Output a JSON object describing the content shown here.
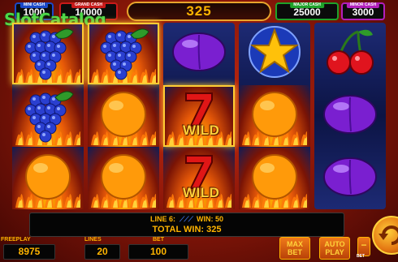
{
  "watermark": "SlotCatalog",
  "jackpots": {
    "mini": {
      "label": "MINI CASH",
      "value": "1000"
    },
    "grand": {
      "label": "GRAND CASH",
      "value": "10000"
    },
    "major": {
      "label": "MAJOR CASH",
      "value": "25000"
    },
    "minor": {
      "label": "MINOR CASH",
      "value": "3000"
    }
  },
  "win_display": "325",
  "reels": [
    [
      "grapes",
      "grapes",
      "orange"
    ],
    [
      "grapes",
      "orange",
      "orange"
    ],
    [
      "plum",
      "wild",
      "wild"
    ],
    [
      "star",
      "orange",
      "orange"
    ],
    [
      "cherries",
      "plum",
      "plum"
    ]
  ],
  "wild_text": "WILD",
  "info": {
    "line_label": "LINE 6:",
    "line_glyph": "⟋⟋⟋",
    "win_label": "WIN: 50",
    "total_win_label": "TOTAL WIN: 325"
  },
  "controls": {
    "freeplay_label": "FREEPLAY",
    "freeplay_value": "8975",
    "lines_label": "LINES",
    "lines_value": "20",
    "bet_label": "BET",
    "bet_value": "100",
    "maxbet_line1": "MAX",
    "maxbet_line2": "BET",
    "autoplay_line1": "AUTO",
    "autoplay_line2": "PLAY",
    "bet_minus": "−",
    "bet_small": "BET"
  },
  "colors": {
    "accent": "#ffb400",
    "background": "#8e1809",
    "reel_blue": "#0c1444",
    "wild_gold": "#ffd23a"
  }
}
